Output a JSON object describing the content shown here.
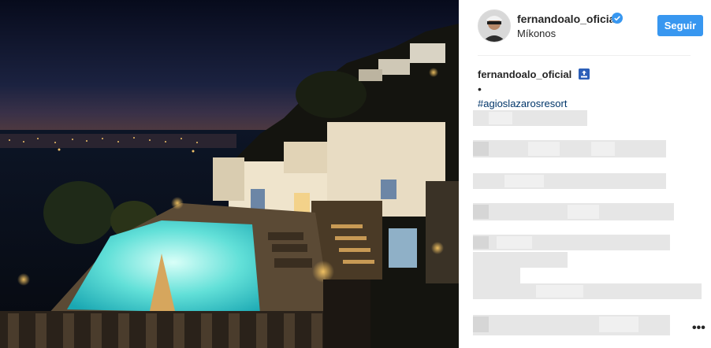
{
  "post": {
    "username": "fernandoalo_oficial",
    "location": "Míkonos",
    "follow_label": "Seguir",
    "caption_user": "fernandoalo_oficial",
    "caption_bullet": "•",
    "hashtag": "#agioslazarosresort",
    "more_label": "•••"
  },
  "icons": {
    "verified": "verified-badge-icon",
    "top_badge": "top-emoji-icon",
    "more": "more-options-icon"
  },
  "colors": {
    "follow_button": "#3897f0",
    "hashtag": "#003569",
    "verified": "#3897f0"
  }
}
